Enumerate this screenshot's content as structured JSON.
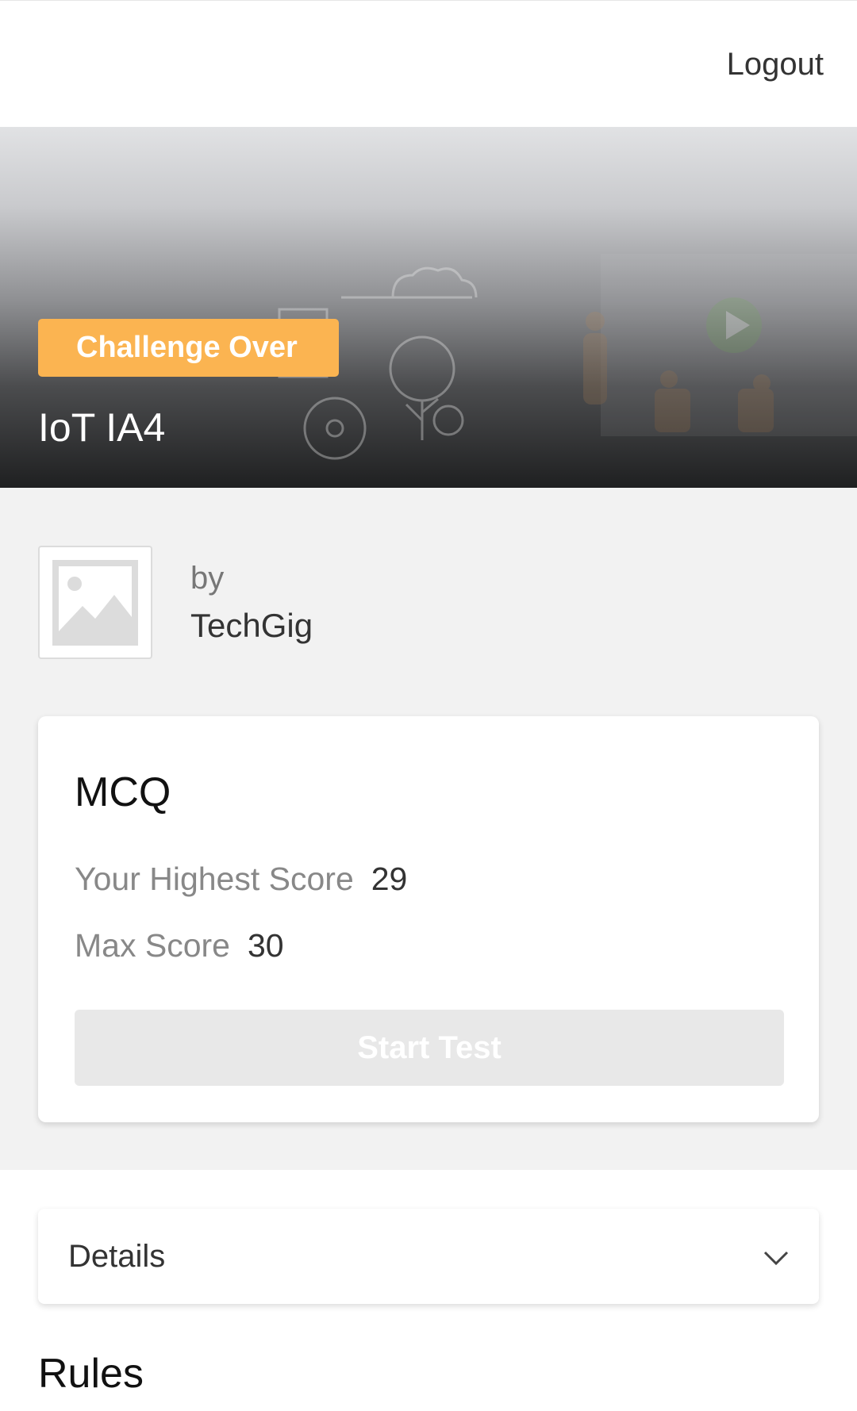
{
  "header": {
    "logout_label": "Logout"
  },
  "hero": {
    "status_badge": "Challenge Over",
    "title": "IoT IA4",
    "badge_color": "#fbb451"
  },
  "organizer": {
    "by_label": "by",
    "name": "TechGig",
    "logo_icon": "image-placeholder-icon"
  },
  "test_card": {
    "title": "MCQ",
    "highest_score_label": "Your Highest Score",
    "highest_score_value": "29",
    "max_score_label": "Max Score",
    "max_score_value": "30",
    "start_button_label": "Start Test"
  },
  "details": {
    "label": "Details",
    "toggle_icon": "chevron-down-icon"
  },
  "rules": {
    "title": "Rules"
  }
}
